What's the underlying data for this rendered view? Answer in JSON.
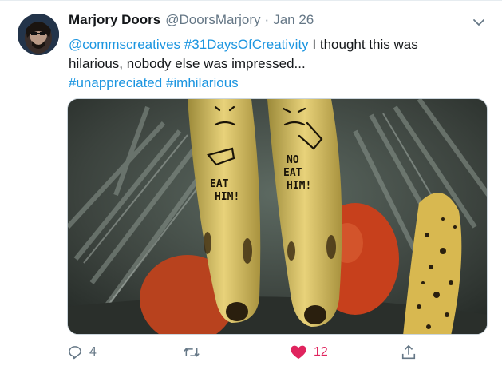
{
  "tweet": {
    "author_name": "Marjory Doors",
    "handle": "@DoorsMarjory",
    "separator": "·",
    "date": "Jan 26",
    "text_parts": {
      "mention": "@commscreatives",
      "hashtag1": "#31DaysOfCreativity",
      "body": " I thought this was hilarious, nobody else was impressed...",
      "hashtag2": "#unappreciated",
      "hashtag3": "#imhilarious"
    },
    "media": {
      "banana_left_text": "EAT HIM!",
      "banana_right_text": "NO EAT HIM!"
    },
    "actions": {
      "reply_count": "4",
      "retweet_count": "",
      "like_count": "12",
      "liked": true
    }
  },
  "colors": {
    "link": "#1b95e0",
    "like": "#e0245e",
    "muted": "#657786"
  },
  "icons": [
    "avatar",
    "chevron-down-icon",
    "reply-icon",
    "retweet-icon",
    "heart-icon",
    "share-icon"
  ]
}
